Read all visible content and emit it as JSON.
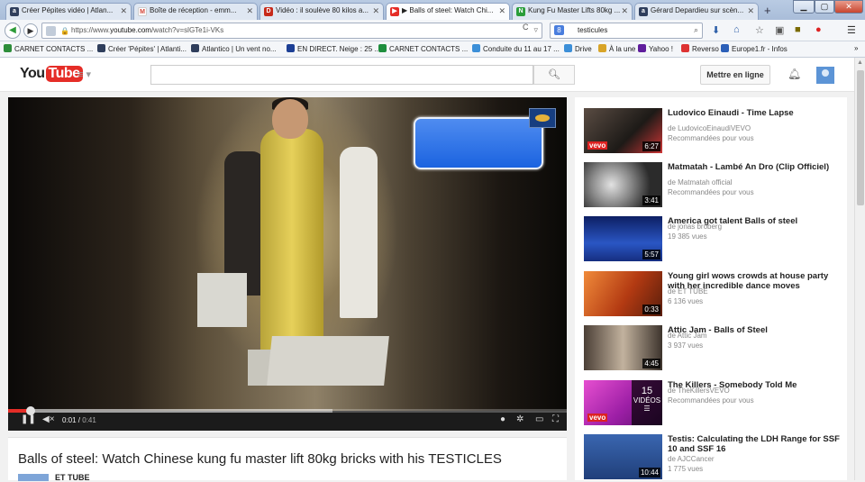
{
  "browser": {
    "tabs": [
      {
        "label": "Créer Pépites vidéo | Atlan...",
        "icon": "atlantico-icon",
        "color": "#2f3e5c",
        "letter": "a"
      },
      {
        "label": "Boîte de réception - emm...",
        "icon": "gmail-icon",
        "color": "#d44638",
        "letter": "M"
      },
      {
        "label": "Vidéo : il soulève 80 kilos a...",
        "icon": "dailymotion-icon",
        "color": "#c72a1b",
        "letter": "D"
      },
      {
        "label": "▶ Balls of steel: Watch Chi...",
        "icon": "youtube-icon",
        "color": "#e52d27",
        "letter": "▶"
      },
      {
        "label": "Kung Fu Master Lifts 80kg ...",
        "icon": "n-site-icon",
        "color": "#2a9d3a",
        "letter": "N"
      },
      {
        "label": "Gérard Depardieu sur scèn...",
        "icon": "atlantico-icon",
        "color": "#2f3e5c",
        "letter": "a"
      }
    ],
    "url_prefix": "https://www.",
    "url_domain": "youtube.com",
    "url_path": "/watch?v=slGTe1i-VKs",
    "search_text": "testicules",
    "bookmarks": [
      "CARNET CONTACTS ...",
      "Créer 'Pépites' | Atlanti...",
      "Atlantico | Un vent no...",
      "EN DIRECT. Neige : 25 ...",
      "CARNET CONTACTS ...",
      "Conduite du 11 au 17 ...",
      "Drive",
      "À la une",
      "Yahoo !",
      "Reverso",
      "Europe1.fr - Infos"
    ],
    "more_bookmarks": "»"
  },
  "youtube": {
    "logo_you": "You",
    "logo_tube": "Tube",
    "search_placeholder": "",
    "upload_label": "Mettre en ligne"
  },
  "player": {
    "current_time": "0:01",
    "duration": "0:41",
    "played_fraction": 0.04,
    "loaded_fraction": 0.58
  },
  "video": {
    "title": "Balls of steel: Watch Chinese kung fu master lift 80kg bricks with his TESTICLES",
    "channel": "ET TUBE"
  },
  "recommendations": [
    {
      "title": "Ludovico Einaudi - Time Lapse",
      "channel": "de LudovicoEinaudiVEVO",
      "meta": "Recommandées pour vous",
      "duration": "6:27",
      "vevo": "vevo",
      "thumb": "#2a2622"
    },
    {
      "title": "Matmatah - Lambé An Dro (Clip Officiel)",
      "channel": "de Matmatah official",
      "meta": "Recommandées pour vous",
      "duration": "3:41",
      "thumb": "#555555"
    },
    {
      "title": "America got talent Balls of steel",
      "channel": "de jonas broberg",
      "meta": "19 385 vues",
      "duration": "5:57",
      "thumb": "#1d3c9a"
    },
    {
      "title": "Young girl wows crowds at house party with her incredible dance moves",
      "channel": "de ET TUBE",
      "meta": "6 136 vues",
      "duration": "0:33",
      "thumb": "#c2501c"
    },
    {
      "title": "Attic Jam - Balls of Steel",
      "channel": "de Attic Jam",
      "meta": "3 937 vues",
      "duration": "4:45",
      "thumb": "#7a6a5c"
    },
    {
      "title": "The Killers - Somebody Told Me",
      "channel": "de TheKillersVEVO",
      "meta": "Recommandées pour vous",
      "vevo": "vevo",
      "playlist_count": "15",
      "playlist_label": "VIDÉOS",
      "thumb": "#c42ab8"
    },
    {
      "title": "Testis: Calculating the LDH Range for SSF 10 and SSF 16",
      "channel": "de AJCCancer",
      "meta": "1 775 vues",
      "duration": "10:44",
      "thumb": "#2c4f8c"
    }
  ]
}
